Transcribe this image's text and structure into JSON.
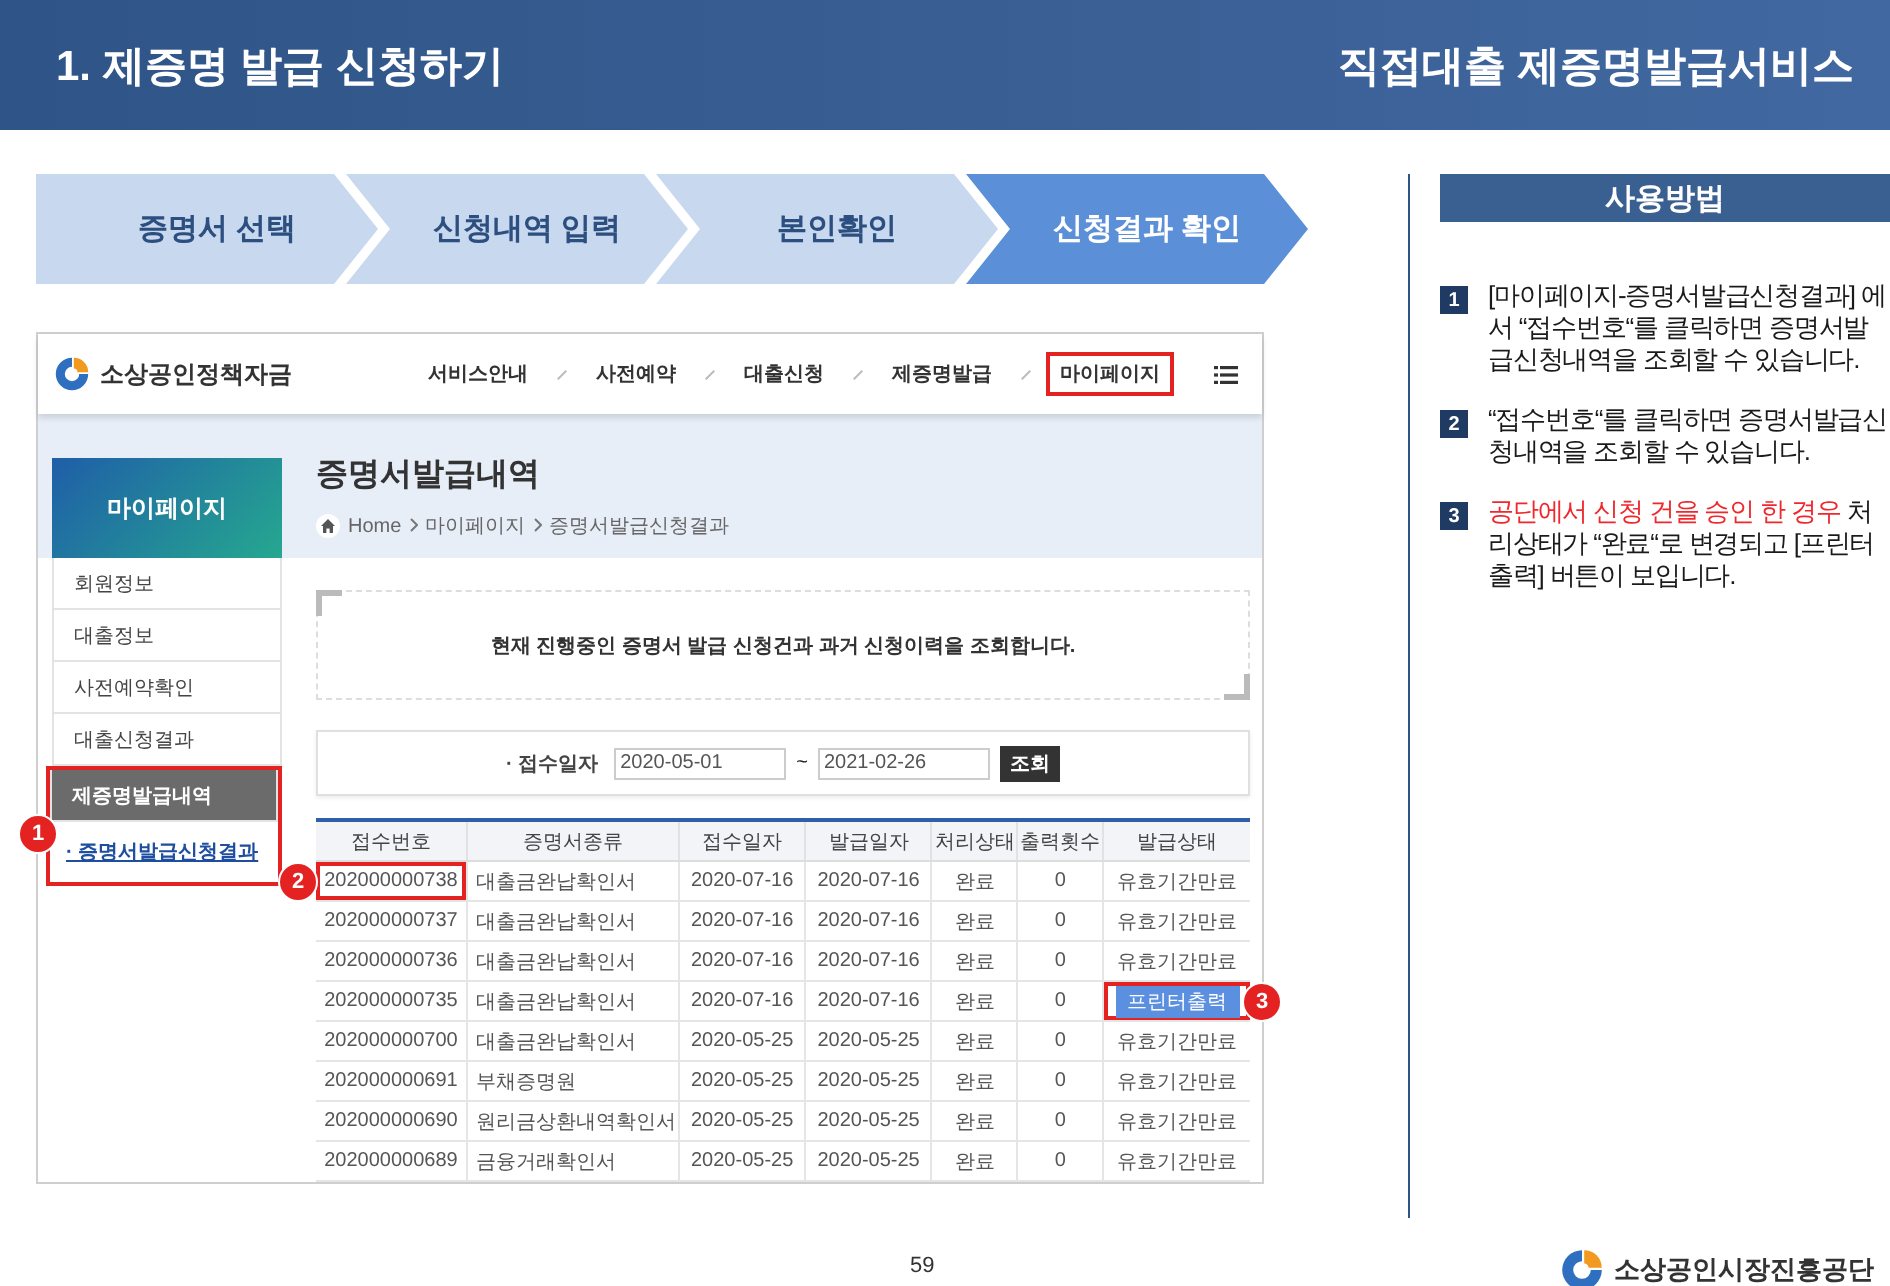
{
  "header": {
    "title": "1. 제증명 발급 신청하기",
    "service": "직접대출 제증명발급서비스"
  },
  "steps": [
    {
      "label": "증명서 선택",
      "selected": false
    },
    {
      "label": "신청내역 입력",
      "selected": false
    },
    {
      "label": "본인확인",
      "selected": false
    },
    {
      "label": "신청결과 확인",
      "selected": true
    }
  ],
  "screenshot": {
    "site_name": "소상공인정책자금",
    "nav": [
      {
        "label": "서비스안내",
        "highlighted": false
      },
      {
        "label": "사전예약",
        "highlighted": false
      },
      {
        "label": "대출신청",
        "highlighted": false
      },
      {
        "label": "제증명발급",
        "highlighted": false
      },
      {
        "label": "마이페이지",
        "highlighted": true
      }
    ],
    "sidebar": {
      "title": "마이페이지",
      "items": [
        {
          "label": "회원정보",
          "kind": "item",
          "selected": false
        },
        {
          "label": "대출정보",
          "kind": "item",
          "selected": false
        },
        {
          "label": "사전예약확인",
          "kind": "item",
          "selected": false
        },
        {
          "label": "대출신청결과",
          "kind": "item",
          "selected": false
        },
        {
          "label": "제증명발급내역",
          "kind": "group",
          "selected": false,
          "callout": "1",
          "children": [
            {
              "label": "· 증명서발급신청결과",
              "selected": true
            }
          ]
        }
      ]
    },
    "page_title": "증명서발급내역",
    "breadcrumb": [
      "Home",
      "마이페이지",
      "증명서발급신청결과"
    ],
    "notice": "현재 진행중인 증명서 발급 신청건과 과거 신청이력을 조회합니다.",
    "search": {
      "label": "· 접수일자",
      "from": "2020-05-01",
      "separator": "~",
      "to": "2021-02-26",
      "button": "조회"
    },
    "table": {
      "columns": [
        "접수번호",
        "증명서종류",
        "접수일자",
        "발급일자",
        "처리상태",
        "출력횟수",
        "발급상태"
      ],
      "rows": [
        {
          "cells": [
            "202000000738",
            "대출금완납확인서",
            "2020-07-16",
            "2020-07-16",
            "완료",
            "0"
          ],
          "callout": "2",
          "issue": {
            "kind": "text",
            "label": "유효기간만료"
          }
        },
        {
          "cells": [
            "202000000737",
            "대출금완납확인서",
            "2020-07-16",
            "2020-07-16",
            "완료",
            "0"
          ],
          "issue": {
            "kind": "text",
            "label": "유효기간만료"
          }
        },
        {
          "cells": [
            "202000000736",
            "대출금완납확인서",
            "2020-07-16",
            "2020-07-16",
            "완료",
            "0"
          ],
          "issue": {
            "kind": "text",
            "label": "유효기간만료"
          }
        },
        {
          "cells": [
            "202000000735",
            "대출금완납확인서",
            "2020-07-16",
            "2020-07-16",
            "완료",
            "0"
          ],
          "issue": {
            "kind": "button",
            "label": "프린터출력",
            "callout": "3"
          }
        },
        {
          "cells": [
            "202000000700",
            "대출금완납확인서",
            "2020-05-25",
            "2020-05-25",
            "완료",
            "0"
          ],
          "issue": {
            "kind": "text",
            "label": "유효기간만료"
          }
        },
        {
          "cells": [
            "202000000691",
            "부채증명원",
            "2020-05-25",
            "2020-05-25",
            "완료",
            "0"
          ],
          "issue": {
            "kind": "text",
            "label": "유효기간만료"
          }
        },
        {
          "cells": [
            "202000000690",
            "원리금상환내역확인서",
            "2020-05-25",
            "2020-05-25",
            "완료",
            "0"
          ],
          "issue": {
            "kind": "text",
            "label": "유효기간만료"
          }
        },
        {
          "cells": [
            "202000000689",
            "금융거래확인서",
            "2020-05-25",
            "2020-05-25",
            "완료",
            "0"
          ],
          "issue": {
            "kind": "text",
            "label": "유효기간만료"
          }
        }
      ]
    }
  },
  "usage": {
    "title": "사용방법",
    "steps": [
      {
        "number": "1",
        "parts": [
          {
            "kind": "plain",
            "text": "[마이페이지-증명서발급신청결과] 에서 “접수번호“를 클릭하면 증명서발급신청내역을 조회할 수 있습니다."
          }
        ]
      },
      {
        "number": "2",
        "parts": [
          {
            "kind": "plain",
            "text": "“접수번호“를 클릭하면 증명서발급신청내역을 조회할 수 있습니다."
          }
        ]
      },
      {
        "number": "3",
        "parts": [
          {
            "kind": "emphasis",
            "text": "공단에서 신청 건을 승인 한 경우"
          },
          {
            "kind": "plain",
            "text": " 처리상태가 “완료“로 변경되고 [프린터 출력] 버튼이 보입니다."
          }
        ]
      }
    ]
  },
  "footer": {
    "page": "59",
    "org": "소상공인시장진흥공단"
  }
}
